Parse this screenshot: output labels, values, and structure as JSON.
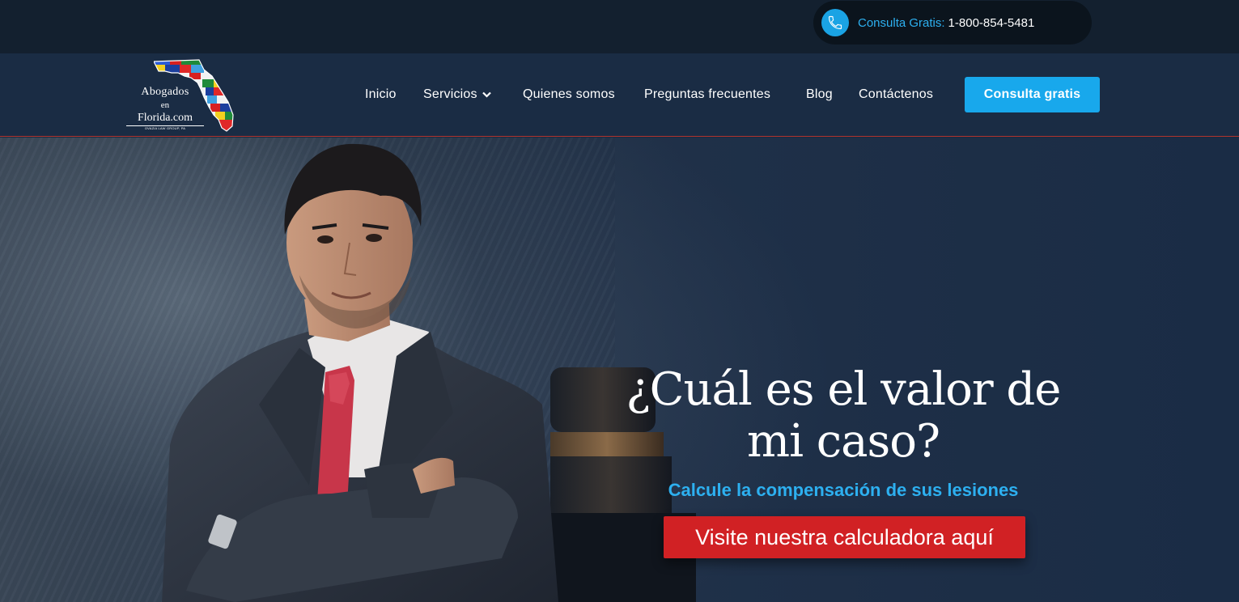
{
  "topbar": {
    "phone_icon": "phone-icon",
    "consult_label": "Consulta Gratis:",
    "phone_number": "1-800-854-5481"
  },
  "logo": {
    "line1": "Abogados",
    "line2": "en",
    "line3": "Florida.com",
    "subline": "OVAZIA LAW GROUP, PA"
  },
  "nav": {
    "items": [
      {
        "label": "Inicio"
      },
      {
        "label": "Servicios",
        "icon": "chevron-down-icon"
      },
      {
        "label": "Quienes somos"
      },
      {
        "label": "Preguntas frecuentes"
      },
      {
        "label": "Blog"
      },
      {
        "label": "Contáctenos"
      }
    ],
    "cta_label": "Consulta gratis"
  },
  "hero": {
    "title_line1": "¿Cuál es el valor de",
    "title_line2": "mi caso?",
    "subtitle": "Calcule la compensación de sus lesiones",
    "button_label": "Visite nuestra calculadora aquí"
  },
  "colors": {
    "accent_blue": "#18a8ec",
    "accent_red": "#d12124",
    "navbar_bg": "#1a2c44",
    "topbar_bg": "#13202f"
  }
}
